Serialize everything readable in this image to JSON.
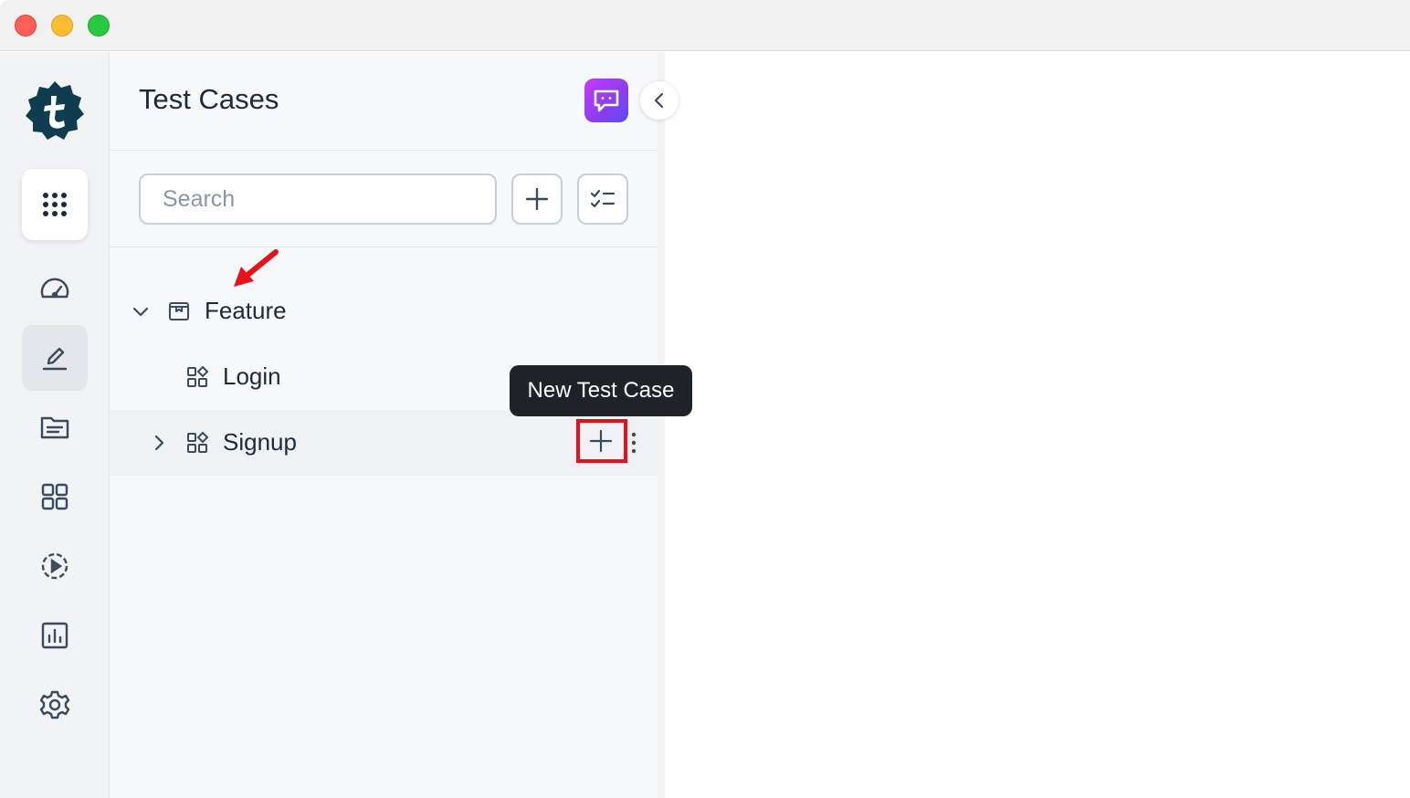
{
  "panel": {
    "title": "Test Cases",
    "search_placeholder": "Search"
  },
  "rail": {
    "items": [
      {
        "name": "apps",
        "icon": "grid-dots-icon"
      },
      {
        "name": "dashboard",
        "icon": "speedometer-icon"
      },
      {
        "name": "test-cases",
        "icon": "pencil-edit-icon",
        "active": true
      },
      {
        "name": "documents",
        "icon": "folder-icon"
      },
      {
        "name": "modules",
        "icon": "squares-grid-icon"
      },
      {
        "name": "runs",
        "icon": "play-circle-icon"
      },
      {
        "name": "reports",
        "icon": "bar-chart-icon"
      },
      {
        "name": "settings",
        "icon": "gear-icon"
      }
    ]
  },
  "tree": {
    "feature": {
      "label": "Feature",
      "expanded": true
    },
    "login": {
      "label": "Login"
    },
    "signup": {
      "label": "Signup",
      "expanded": false
    }
  },
  "tooltip": {
    "text": "New Test Case"
  },
  "colors": {
    "accent_gradient_start": "#c43cf5",
    "accent_gradient_end": "#5a4bf2",
    "highlight": "#e8101a",
    "tooltip_bg": "#1f2328",
    "text_primary": "#1c2a3a"
  }
}
